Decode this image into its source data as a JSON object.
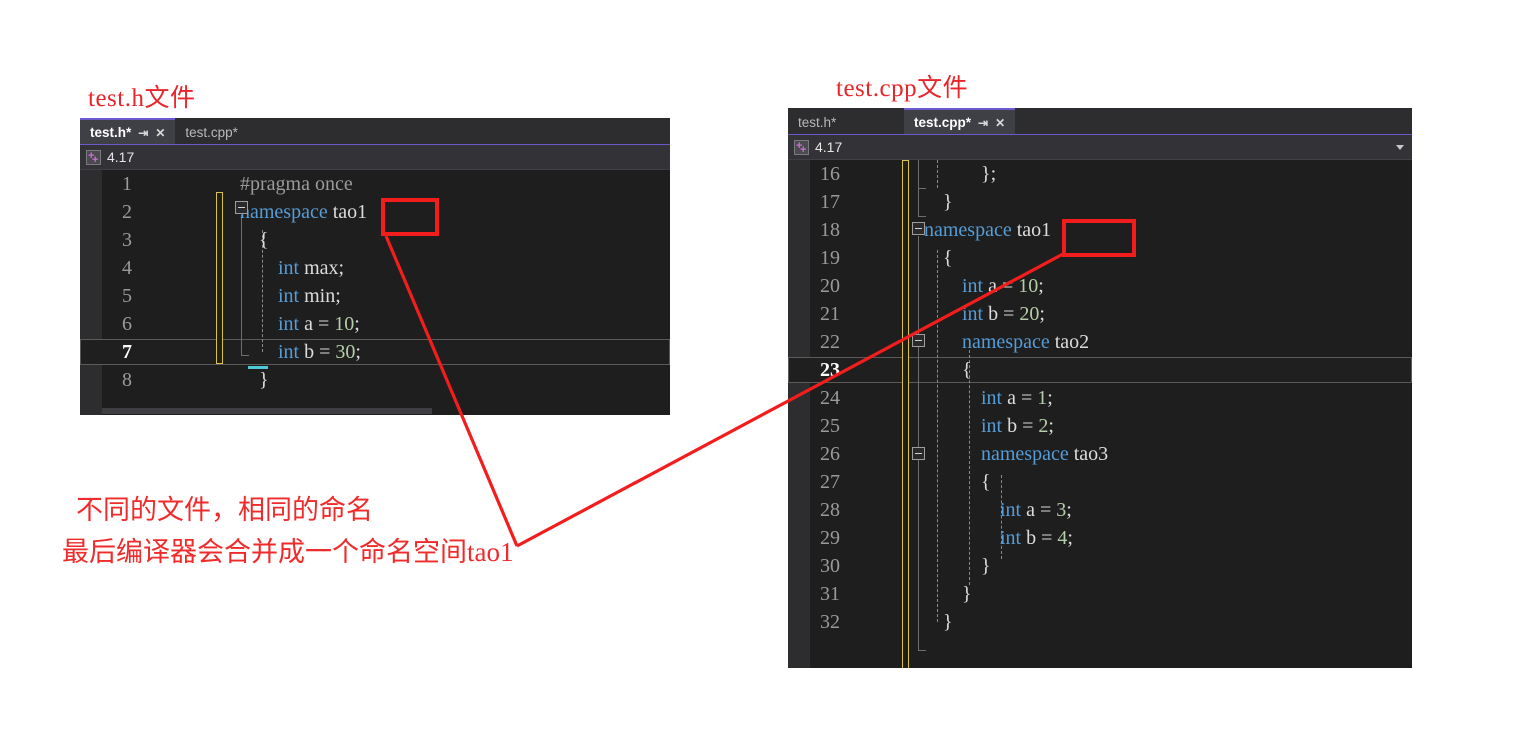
{
  "captions": {
    "left": "test.h文件",
    "right": "test.cpp文件"
  },
  "notes": {
    "line1": "不同的文件，相同的命名",
    "line2": "最后编译器会合并成一个命名空间tao1"
  },
  "colors": {
    "annotation_red": "#ef2b2b",
    "highlight_box_red": "#f41d1d",
    "editor_background": "#1e1e1e",
    "tab_active_background": "#3f3f46",
    "tab_accent": "#6a5acd",
    "keyword_blue": "#569cd6",
    "number_green": "#b5cea8",
    "identifier_gray": "#dcdcdc",
    "line_number_gray": "#9a9a9a",
    "change_bar_yellow": "#d7c43c"
  },
  "left_editor": {
    "tabs": [
      {
        "label": "test.h*",
        "active": true,
        "pin_icon": "pin-icon",
        "close_icon": "close-icon"
      },
      {
        "label": "test.cpp*",
        "active": false
      }
    ],
    "navbar": {
      "icon": "cpp-project-icon",
      "text": "4.17",
      "chevron": "chevron-down-icon"
    },
    "current_line": 7,
    "lines": [
      {
        "n": "1",
        "tokens": [
          {
            "t": "#pragma once",
            "c": "pp"
          }
        ],
        "indent": 0
      },
      {
        "n": "2",
        "tokens": [
          {
            "t": "namespace ",
            "c": "kw"
          },
          {
            "t": "tao1",
            "c": "id"
          }
        ],
        "indent": 0
      },
      {
        "n": "3",
        "tokens": [
          {
            "t": "{",
            "c": "brace"
          }
        ],
        "indent": 1
      },
      {
        "n": "4",
        "tokens": [
          {
            "t": "int",
            "c": "kw"
          },
          {
            "t": " max;",
            "c": "id"
          }
        ],
        "indent": 2
      },
      {
        "n": "5",
        "tokens": [
          {
            "t": "int",
            "c": "kw"
          },
          {
            "t": " min;",
            "c": "id"
          }
        ],
        "indent": 2
      },
      {
        "n": "6",
        "tokens": [
          {
            "t": "int",
            "c": "kw"
          },
          {
            "t": " a = ",
            "c": "id"
          },
          {
            "t": "10",
            "c": "num"
          },
          {
            "t": ";",
            "c": "id"
          }
        ],
        "indent": 2
      },
      {
        "n": "7",
        "tokens": [
          {
            "t": "int",
            "c": "kw"
          },
          {
            "t": " b = ",
            "c": "id"
          },
          {
            "t": "30",
            "c": "num"
          },
          {
            "t": ";",
            "c": "id"
          }
        ],
        "indent": 2
      },
      {
        "n": "8",
        "tokens": [
          {
            "t": "}",
            "c": "brace"
          }
        ],
        "indent": 1
      }
    ],
    "highlight": {
      "text": "tao1",
      "line": 2
    }
  },
  "right_editor": {
    "tabs": [
      {
        "label": "test.h*",
        "active": false
      },
      {
        "label": "test.cpp*",
        "active": true,
        "pin_icon": "pin-icon",
        "close_icon": "close-icon"
      }
    ],
    "navbar": {
      "icon": "cpp-project-icon",
      "text": "4.17",
      "chevron": "chevron-down-icon"
    },
    "current_line": 23,
    "lines": [
      {
        "n": "16",
        "tokens": [
          {
            "t": "};",
            "c": "brace"
          }
        ],
        "indent": 3
      },
      {
        "n": "17",
        "tokens": [
          {
            "t": "}",
            "c": "brace"
          }
        ],
        "indent": 1
      },
      {
        "n": "18",
        "tokens": [
          {
            "t": "namespace ",
            "c": "kw"
          },
          {
            "t": "tao1",
            "c": "id"
          }
        ],
        "indent": 0
      },
      {
        "n": "19",
        "tokens": [
          {
            "t": "{",
            "c": "brace"
          }
        ],
        "indent": 1
      },
      {
        "n": "20",
        "tokens": [
          {
            "t": "int",
            "c": "kw"
          },
          {
            "t": " a = ",
            "c": "id"
          },
          {
            "t": "10",
            "c": "num"
          },
          {
            "t": ";",
            "c": "id"
          }
        ],
        "indent": 2
      },
      {
        "n": "21",
        "tokens": [
          {
            "t": "int",
            "c": "kw"
          },
          {
            "t": " b = ",
            "c": "id"
          },
          {
            "t": "20",
            "c": "num"
          },
          {
            "t": ";",
            "c": "id"
          }
        ],
        "indent": 2
      },
      {
        "n": "22",
        "tokens": [
          {
            "t": "namespace ",
            "c": "kw"
          },
          {
            "t": "tao2",
            "c": "id"
          }
        ],
        "indent": 2
      },
      {
        "n": "23",
        "tokens": [
          {
            "t": "{",
            "c": "brace"
          }
        ],
        "indent": 2
      },
      {
        "n": "24",
        "tokens": [
          {
            "t": "int",
            "c": "kw"
          },
          {
            "t": " a = ",
            "c": "id"
          },
          {
            "t": "1",
            "c": "num"
          },
          {
            "t": ";",
            "c": "id"
          }
        ],
        "indent": 3
      },
      {
        "n": "25",
        "tokens": [
          {
            "t": "int",
            "c": "kw"
          },
          {
            "t": " b = ",
            "c": "id"
          },
          {
            "t": "2",
            "c": "num"
          },
          {
            "t": ";",
            "c": "id"
          }
        ],
        "indent": 3
      },
      {
        "n": "26",
        "tokens": [
          {
            "t": "namespace ",
            "c": "kw"
          },
          {
            "t": "tao3",
            "c": "id"
          }
        ],
        "indent": 3
      },
      {
        "n": "27",
        "tokens": [
          {
            "t": "{",
            "c": "brace"
          }
        ],
        "indent": 3
      },
      {
        "n": "28",
        "tokens": [
          {
            "t": "int",
            "c": "kw"
          },
          {
            "t": " a = ",
            "c": "id"
          },
          {
            "t": "3",
            "c": "num"
          },
          {
            "t": ";",
            "c": "id"
          }
        ],
        "indent": 4
      },
      {
        "n": "29",
        "tokens": [
          {
            "t": "int",
            "c": "kw"
          },
          {
            "t": " b = ",
            "c": "id"
          },
          {
            "t": "4",
            "c": "num"
          },
          {
            "t": ";",
            "c": "id"
          }
        ],
        "indent": 4
      },
      {
        "n": "30",
        "tokens": [
          {
            "t": "}",
            "c": "brace"
          }
        ],
        "indent": 3
      },
      {
        "n": "31",
        "tokens": [
          {
            "t": "}",
            "c": "brace"
          }
        ],
        "indent": 2
      },
      {
        "n": "32",
        "tokens": [
          {
            "t": "}",
            "c": "brace"
          }
        ],
        "indent": 1
      }
    ],
    "highlight": {
      "text": "tao1",
      "line": 18
    }
  }
}
